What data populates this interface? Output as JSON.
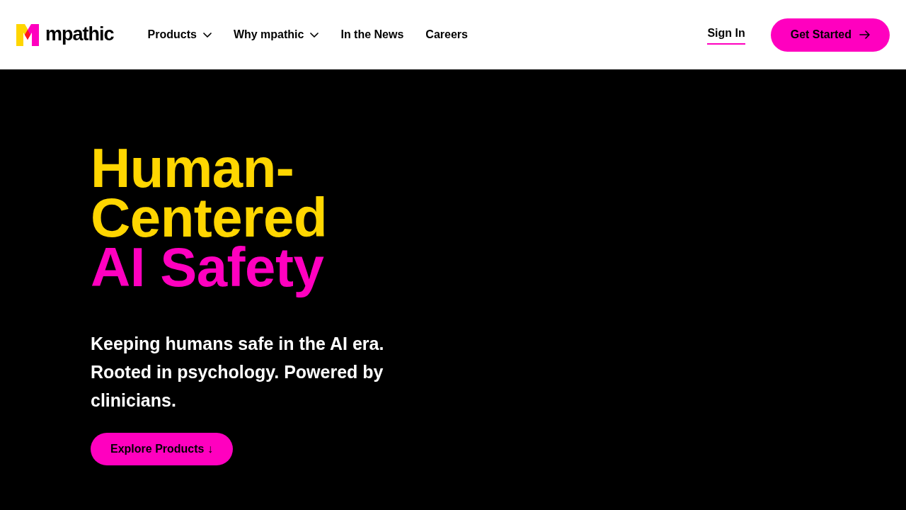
{
  "header": {
    "logo": {
      "text": "mpathic"
    },
    "nav": [
      {
        "label": "Products",
        "has_menu": true
      },
      {
        "label": "Why mpathic",
        "has_menu": true
      },
      {
        "label": "In the News",
        "has_menu": false
      },
      {
        "label": "Careers",
        "has_menu": false
      }
    ],
    "sign_in": {
      "label": "Sign In"
    },
    "cta": {
      "label": "Get Started"
    }
  },
  "hero": {
    "headline": [
      {
        "text": "Human-Centered",
        "kind": "plain"
      },
      {
        "text": "AI Safety",
        "kind": "accent"
      }
    ],
    "subtitle": "Keeping humans safe in the AI era. Rooted in psychology. Powered by clinicians.",
    "button": {
      "label": "Explore Products ↓"
    }
  }
}
